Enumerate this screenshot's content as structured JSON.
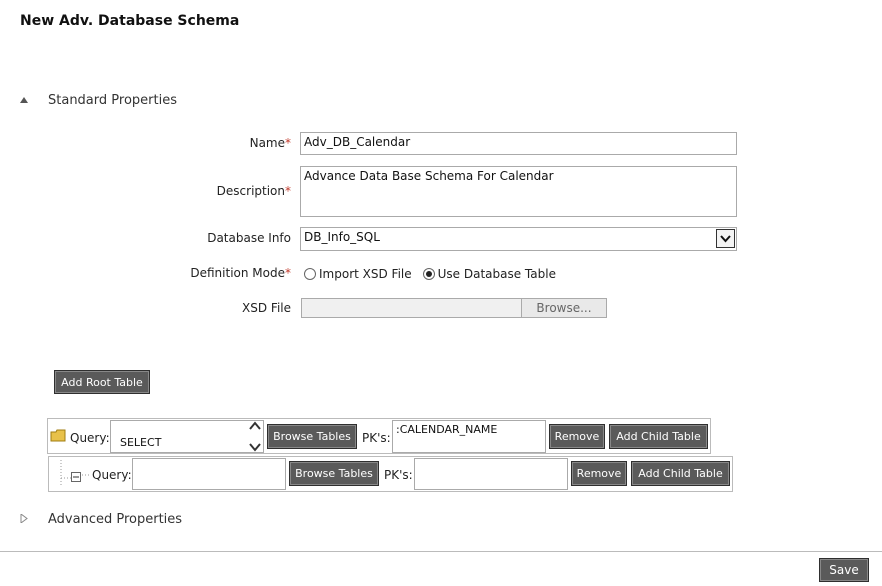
{
  "page": {
    "title": "New Adv. Database Schema"
  },
  "standard_section": {
    "label": "Standard Properties",
    "expanded": true
  },
  "advanced_section": {
    "label": "Advanced Properties",
    "expanded": false
  },
  "form": {
    "name_label": "Name",
    "name_value": "Adv_DB_Calendar",
    "description_label": "Description",
    "description_value": "Advance Data Base Schema For Calendar",
    "database_info_label": "Database Info",
    "database_info_value": "DB_Info_SQL",
    "definition_mode_label": "Definition Mode",
    "mode_options": [
      "Import XSD File",
      "Use Database Table"
    ],
    "mode_selected": "Use Database Table",
    "xsd_file_label": "XSD File",
    "xsd_file_value": "",
    "browse_label": "Browse...",
    "required_marker": "*"
  },
  "tables": {
    "add_root_label": "Add Root Table",
    "root": {
      "query_label": "Query:",
      "query_value": "SELECT\nCALENDAR_NAME,CALE",
      "browse_tables_label": "Browse Tables",
      "pks_label": "PK's:",
      "pks_value": ":CALENDAR_NAME",
      "remove_label": "Remove",
      "add_child_label": "Add Child Table"
    },
    "child": {
      "query_label": "Query:",
      "query_value": "",
      "browse_tables_label": "Browse Tables",
      "pks_label": "PK's:",
      "pks_value": "",
      "remove_label": "Remove",
      "add_child_label": "Add Child Table"
    }
  },
  "footer": {
    "save_label": "Save"
  },
  "colors": {
    "button_bg": "#5a5a5a",
    "required": "#c0392b",
    "folder": "#e8c14a"
  },
  "icons": [
    "expand-triangle-icon",
    "collapse-triangle-icon",
    "chevron-down-icon",
    "folder-icon",
    "tree-minus-icon"
  ]
}
